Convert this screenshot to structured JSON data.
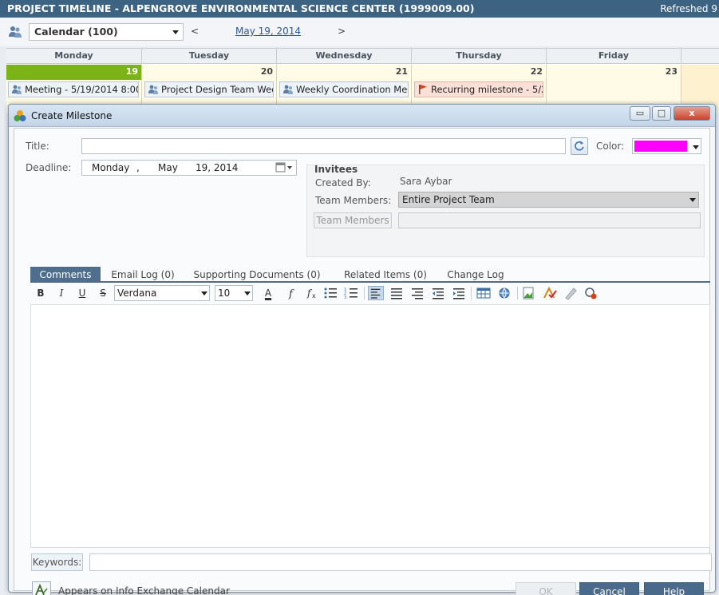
{
  "header": {
    "title": "PROJECT TIMELINE - ALPENGROVE ENVIRONMENTAL SCIENCE CENTER (1999009.00)",
    "refreshed": "Refreshed 9"
  },
  "calendar_toolbar": {
    "calendar_select": "Calendar (100)",
    "prev": "<",
    "current_date": "May 19, 2014",
    "next": ">"
  },
  "calendar": {
    "days": [
      {
        "name": "Monday",
        "num": "19",
        "event": "Meeting - 5/19/2014 8:00 ...",
        "event_type": "meeting"
      },
      {
        "name": "Tuesday",
        "num": "20",
        "event": "Project Design Team Week...",
        "event_type": "meeting"
      },
      {
        "name": "Wednesday",
        "num": "21",
        "event": "Weekly Coordination Meeti...",
        "event_type": "meeting"
      },
      {
        "name": "Thursday",
        "num": "22",
        "event": "Recurring milestone - 5/22/...",
        "event_type": "milestone"
      },
      {
        "name": "Friday",
        "num": "23",
        "event": "",
        "event_type": ""
      }
    ]
  },
  "dialog": {
    "title": "Create Milestone",
    "window_buttons": {
      "minimize": "▭",
      "maximize": "□",
      "close": "x"
    },
    "title_label": "Title:",
    "title_value": "",
    "color_label": "Color:",
    "color_value": "#ff00ff",
    "deadline_label": "Deadline:",
    "deadline": {
      "weekday": "Monday",
      "sep": ",",
      "month": "May",
      "day_year": "19, 2014"
    },
    "invitees": {
      "title": "Invitees",
      "created_by_label": "Created By:",
      "created_by": "Sara Aybar",
      "team_members_label": "Team Members:",
      "team_members_value": "Entire Project Team",
      "team_members_button": "Team Members"
    },
    "tabs": [
      {
        "label": "Comments",
        "active": true
      },
      {
        "label": "Email Log (0)",
        "active": false
      },
      {
        "label": "Supporting Documents (0)",
        "active": false
      },
      {
        "label": "Related Items (0)",
        "active": false
      },
      {
        "label": "Change Log",
        "active": false
      }
    ],
    "editor_toolbar": {
      "bold": "B",
      "italic": "I",
      "underline": "U",
      "strike": "S",
      "font": "Verdana",
      "size": "10",
      "font_color": "A"
    },
    "keywords_label": "Keywords:",
    "keywords_value": "",
    "info_exchange_text": "Appears on Info Exchange Calendar",
    "buttons": {
      "ok": "OK",
      "cancel": "Cancel",
      "help": "Help"
    }
  },
  "colors": {
    "header_bg": "#3d6383",
    "today": "#7cb316",
    "accent": "#4a6a8b",
    "milestone_color": "#ff00ff"
  }
}
